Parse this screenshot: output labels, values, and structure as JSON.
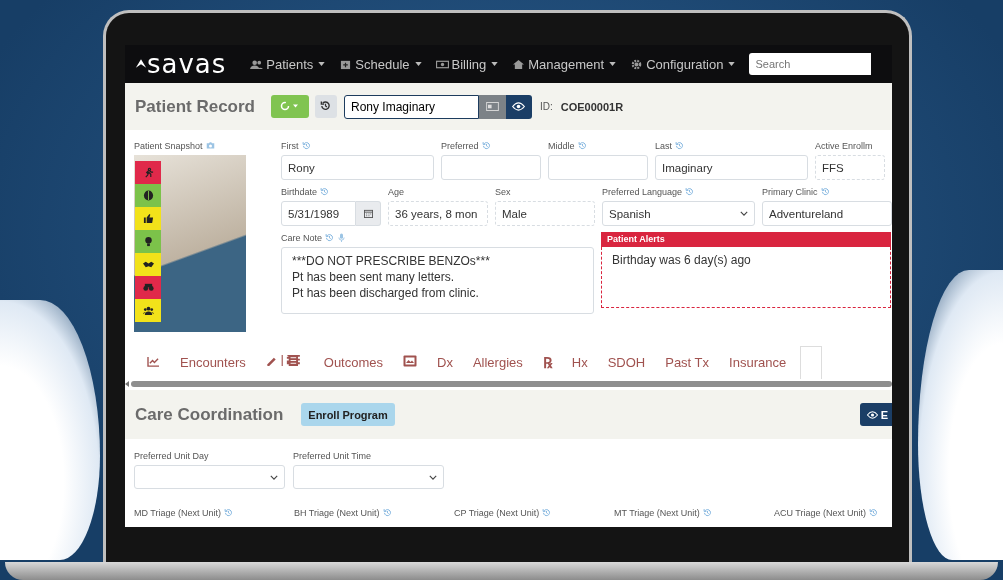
{
  "navbar": {
    "logo": "savas",
    "menus": [
      {
        "label": "Patients"
      },
      {
        "label": "Schedule"
      },
      {
        "label": "Billing"
      },
      {
        "label": "Management"
      },
      {
        "label": "Configuration"
      }
    ],
    "search": {
      "placeholder": "Search"
    }
  },
  "header": {
    "title": "Patient Record",
    "patient_name": "Rony Imaginary",
    "id_label": "ID:",
    "id_value": "COE00001R"
  },
  "snapshot": {
    "label": "Patient Snapshot",
    "status_icons": [
      {
        "color": "#e0294a"
      },
      {
        "color": "#7cc24a"
      },
      {
        "color": "#f2e21a"
      },
      {
        "color": "#7cc24a"
      },
      {
        "color": "#f2e21a"
      },
      {
        "color": "#e0294a"
      },
      {
        "color": "#f2e21a"
      }
    ]
  },
  "fields": [
    [
      {
        "label": "First",
        "history": true,
        "kind": "text",
        "value": "Rony"
      },
      {
        "label": "Preferred",
        "history": true,
        "kind": "text"
      },
      {
        "label": "Middle",
        "history": true,
        "kind": "text"
      },
      {
        "label": "Last",
        "history": true,
        "kind": "text",
        "value": "Imaginary"
      },
      {
        "label": "Active Enrollm",
        "history": false,
        "kind": "readonly",
        "value": "FFS"
      }
    ],
    [
      {
        "label": "Birthdate",
        "history": true,
        "kind": "date",
        "value": "5/31/1989"
      },
      {
        "label": "Age",
        "history": false,
        "kind": "readonly",
        "value": "36 years, 8 mon"
      },
      {
        "label": "Sex",
        "history": false,
        "kind": "readonly",
        "value": "Male"
      },
      {
        "label": "Preferred Language",
        "history": true,
        "kind": "select",
        "value": "Spanish"
      },
      {
        "label": "Primary Clinic",
        "history": true,
        "kind": "text",
        "value": "Adventureland"
      }
    ]
  ],
  "care_note": {
    "label": "Care Note",
    "lines": [
      "***DO NOT PRESCRIBE BENZOs***",
      "Pt has been sent many letters.",
      "Pt has been discharged from clinic."
    ]
  },
  "patient_alerts": {
    "title": "Patient Alerts",
    "text": "Birthday was 6 day(s) ago"
  },
  "tabs": [
    {
      "kind": "chart"
    },
    {
      "kind": "text",
      "label": "Encounters"
    },
    {
      "kind": "pencil-building"
    },
    {
      "kind": "text",
      "label": "Outcomes"
    },
    {
      "kind": "picture"
    },
    {
      "kind": "text",
      "label": "Dx"
    },
    {
      "kind": "text",
      "label": "Allergies"
    },
    {
      "kind": "glyph",
      "label": "℞"
    },
    {
      "kind": "text",
      "label": "Hx"
    },
    {
      "kind": "text",
      "label": "SDOH"
    },
    {
      "kind": "text",
      "label": "Past Tx"
    },
    {
      "kind": "text",
      "label": "Insurance"
    }
  ],
  "care_coordination": {
    "title": "Care Coordination",
    "enroll_button": "Enroll Program",
    "view_button": "E",
    "unit_selects": [
      {
        "label": "Preferred Unit Day"
      },
      {
        "label": "Preferred Unit Time"
      }
    ],
    "triage_labels": [
      "MD Triage (Next Unit)",
      "BH Triage (Next Unit)",
      "CP Triage (Next Unit)",
      "MT Triage (Next Unit)",
      "ACU Triage (Next Unit)"
    ]
  }
}
